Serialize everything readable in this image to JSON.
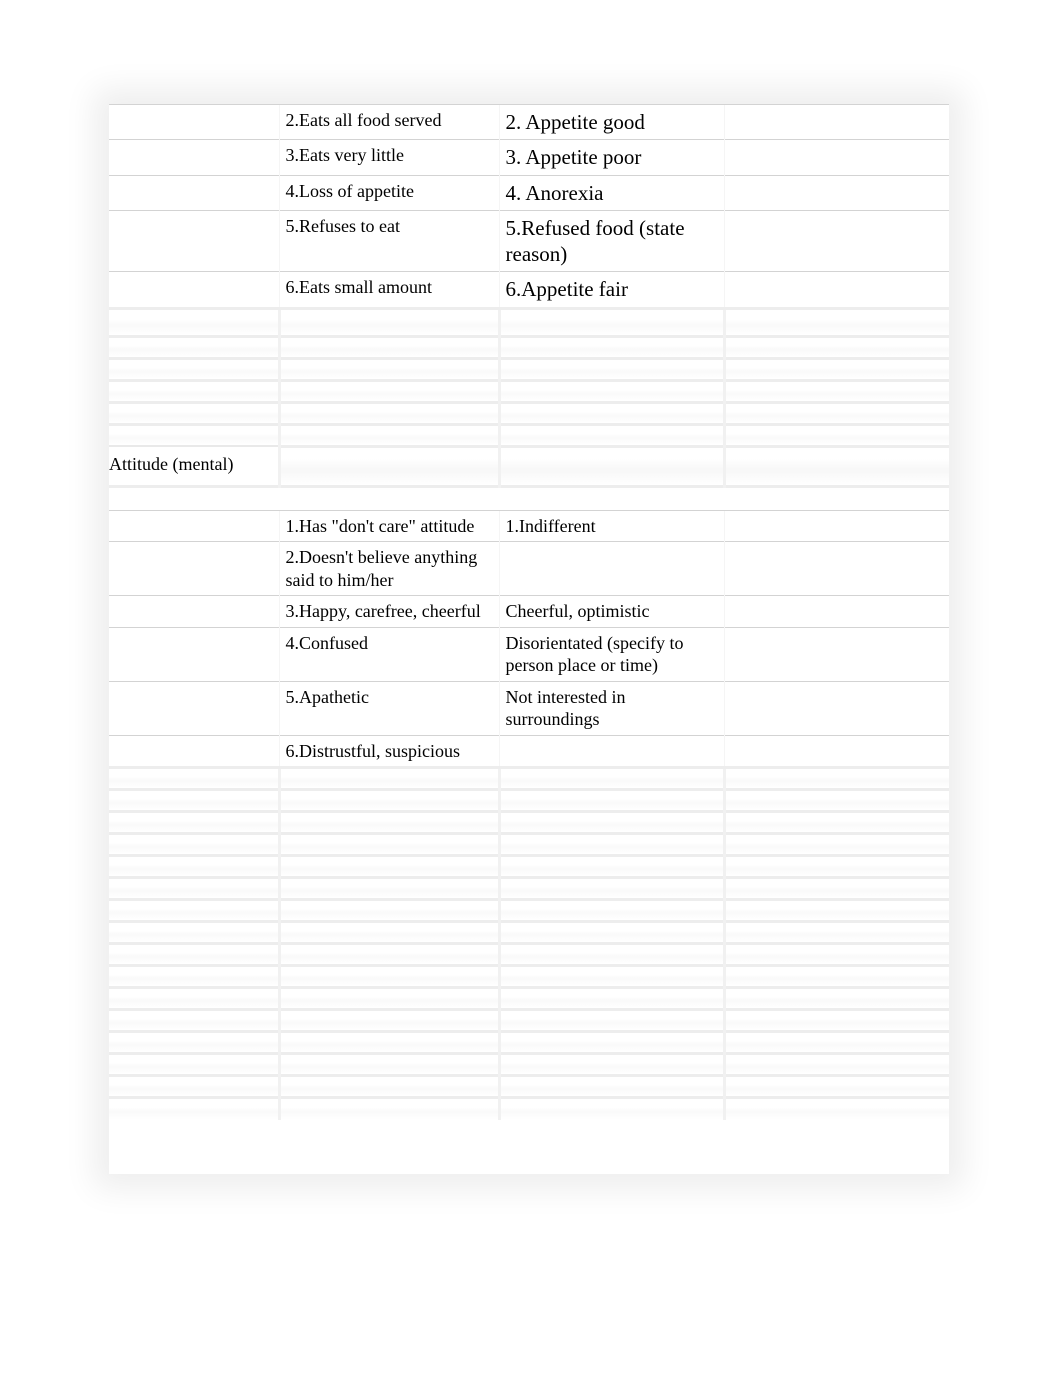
{
  "appetite_rows": [
    {
      "col2": "2.Eats all food served",
      "col3": "2. Appetite good",
      "col3_class": "col3-font"
    },
    {
      "col2": "3.Eats very little",
      "col3": "3. Appetite poor",
      "col3_class": "col3-font"
    },
    {
      "col2": "4.Loss of appetite",
      "col3": "4. Anorexia",
      "col3_class": "col3-font"
    },
    {
      "col2": "5.Refuses to eat",
      "col3": "5.Refused food (state reason)",
      "col3_class": "col3-font"
    },
    {
      "col2": "6.Eats small amount",
      "col3": "6.Appetite fair",
      "col3_class": "col3-font"
    }
  ],
  "section_label": "Attitude (mental)",
  "attitude_rows": [
    {
      "col2": "1.Has \"don't care\" attitude",
      "col3": "1.Indifferent",
      "col3_class": "col3-small"
    },
    {
      "col2": "2.Doesn't believe anything said to him/her",
      "col3": "",
      "col3_class": "col3-small"
    },
    {
      "col2": "3.Happy, carefree, cheerful",
      "col3": "Cheerful, optimistic",
      "col3_class": "col3-small"
    },
    {
      "col2": "4.Confused",
      "col3": "Disorientated (specify to person place or time)",
      "col3_class": "col3-small"
    },
    {
      "col2": "5.Apathetic",
      "col3": "Not interested in surroundings",
      "col3_class": "col3-small"
    },
    {
      "col2": "6.Distrustful, suspicious",
      "col3": "",
      "col3_class": "col3-small"
    }
  ],
  "blur_rows_between": 6,
  "blur_rows_after": 16
}
